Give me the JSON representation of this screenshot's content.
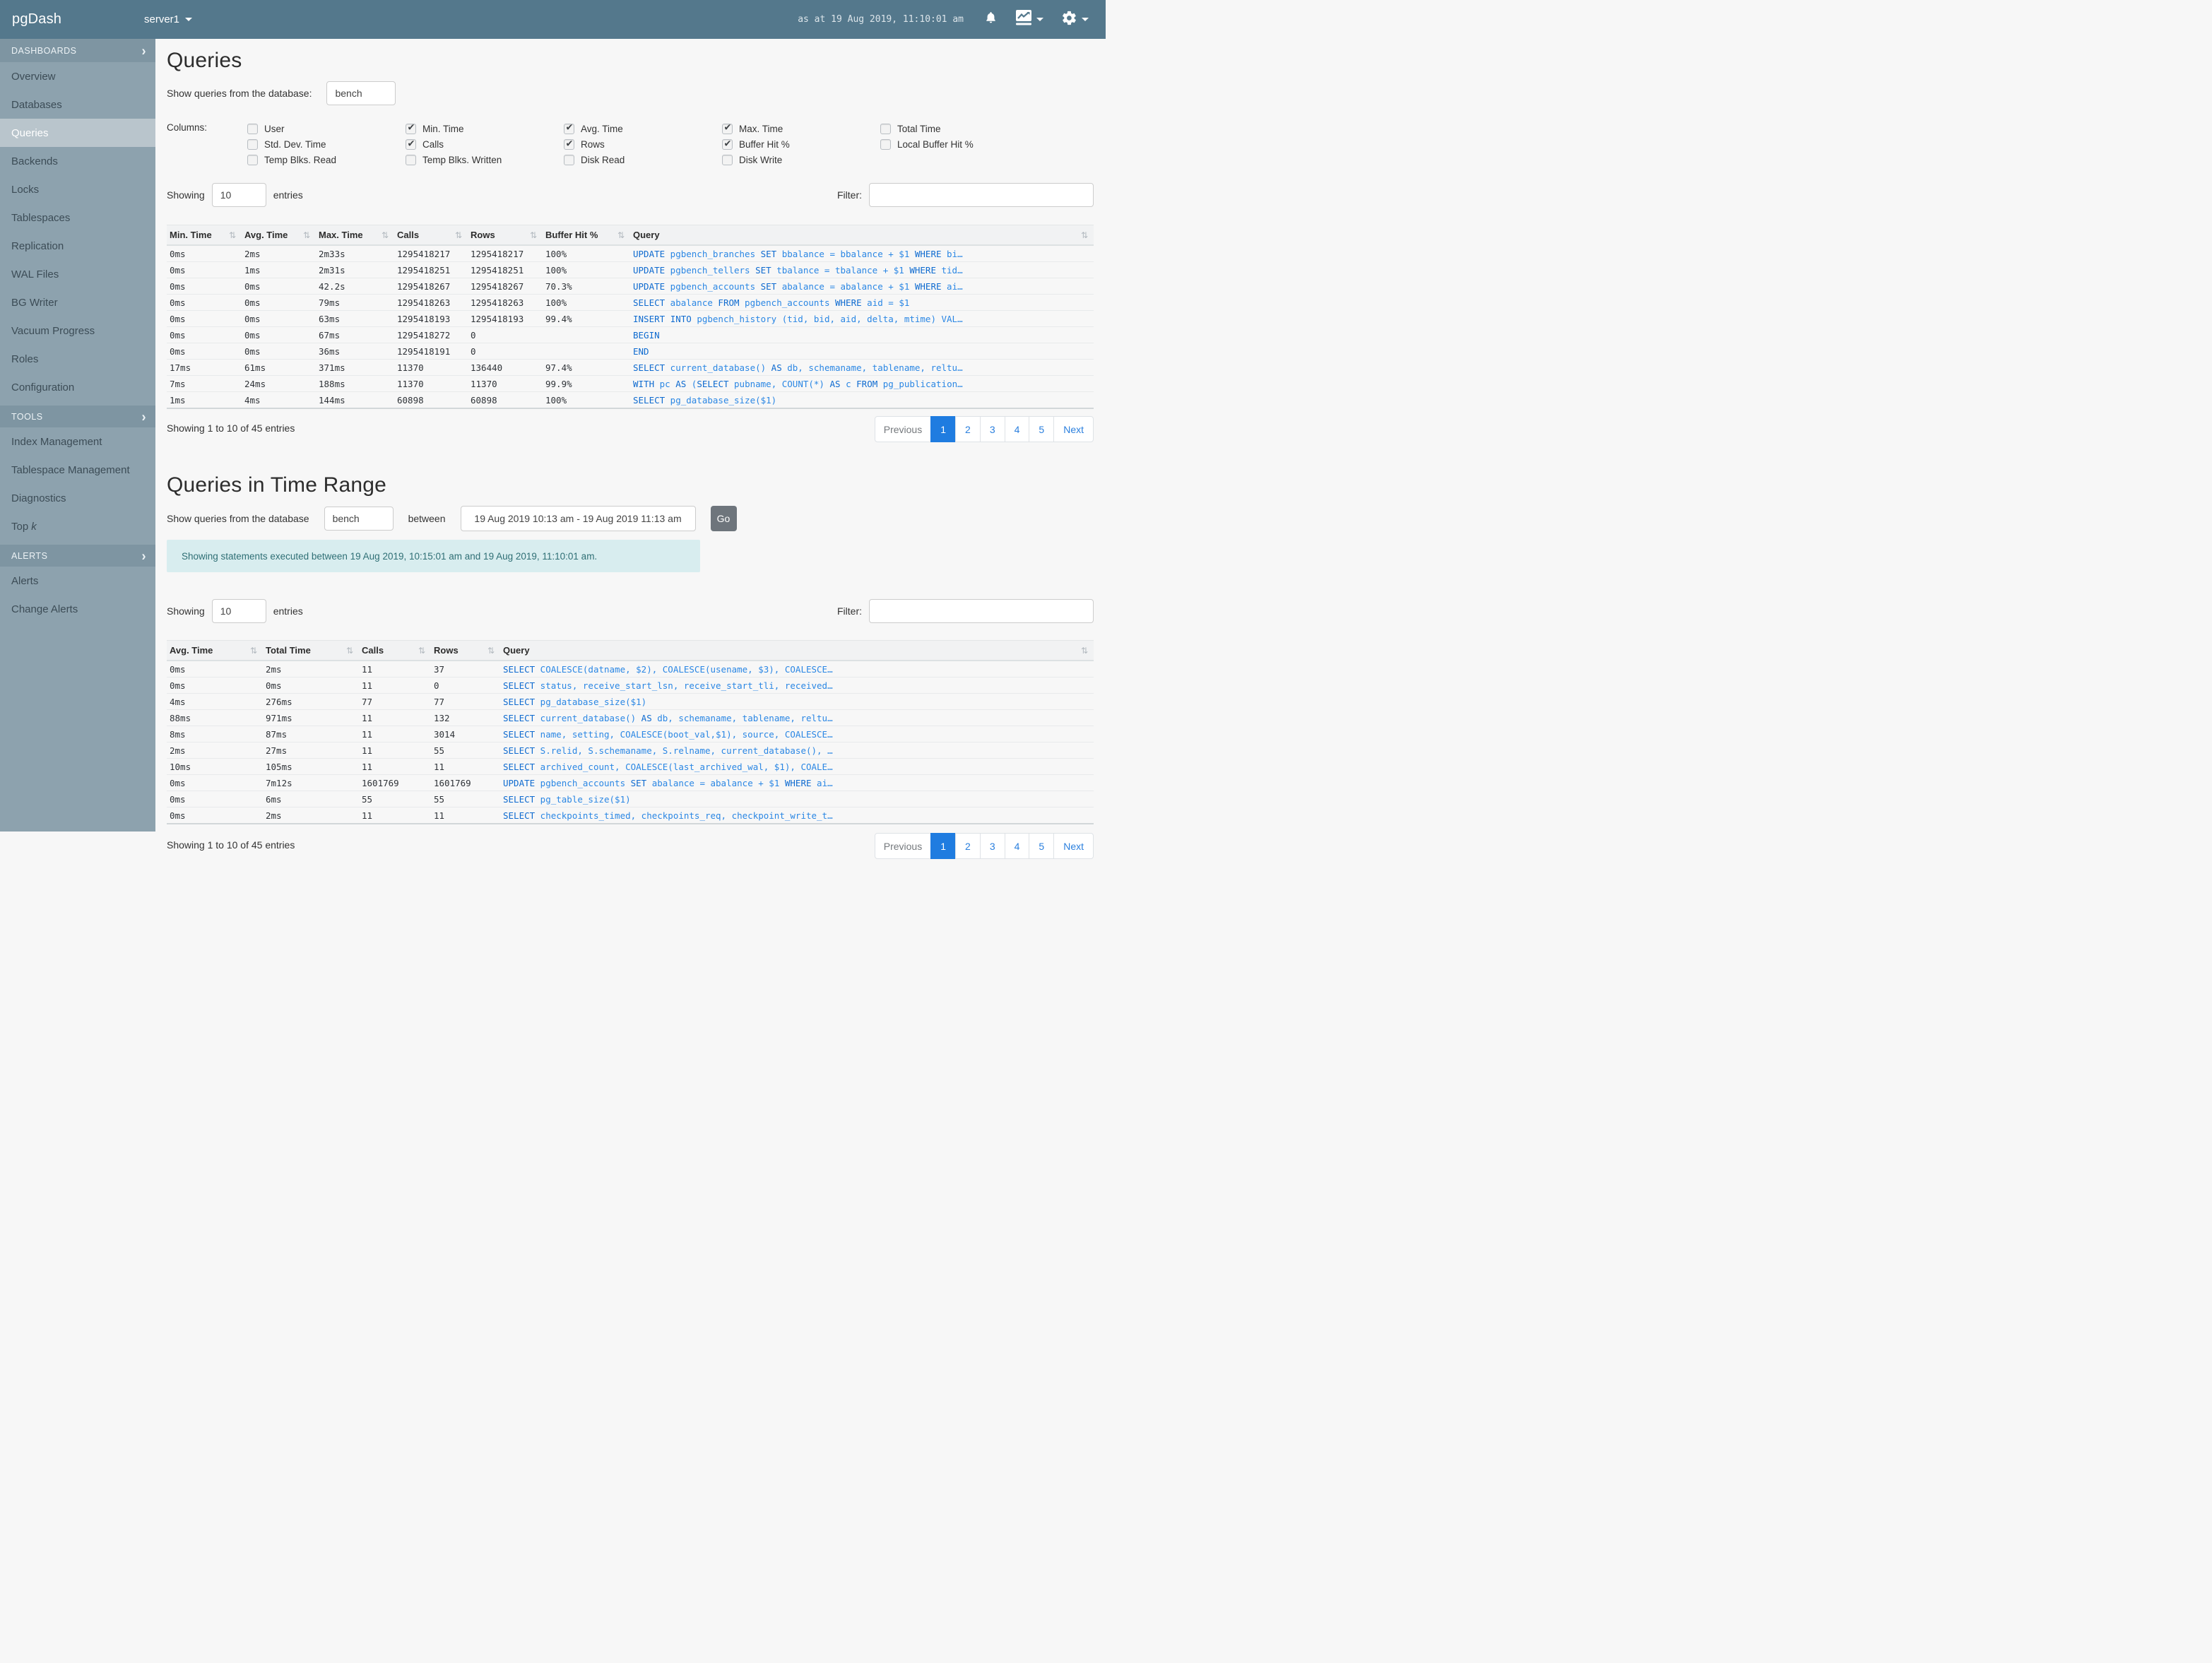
{
  "colors": {
    "navbar_bg": "#54788c",
    "sidebar_bg": "#8da2ae",
    "active_page_bg": "#1f7ce0",
    "query_link": "#2b87e4",
    "banner_bg": "#d8edef",
    "banner_text": "#2f6f75"
  },
  "navbar": {
    "brand": "pgDash",
    "server_selector": "server1",
    "timestamp": "as at 19 Aug 2019, 11:10:01 am",
    "icons": [
      "bell-icon",
      "chart-menu-icon",
      "gear-menu-icon"
    ]
  },
  "sidebar": {
    "sections": [
      {
        "label": "DASHBOARDS",
        "items": [
          {
            "label": "Overview"
          },
          {
            "label": "Databases"
          },
          {
            "label": "Queries",
            "active": true
          },
          {
            "label": "Backends"
          },
          {
            "label": "Locks"
          },
          {
            "label": "Tablespaces"
          },
          {
            "label": "Replication"
          },
          {
            "label": "WAL Files"
          },
          {
            "label": "BG Writer"
          },
          {
            "label": "Vacuum Progress"
          },
          {
            "label": "Roles"
          },
          {
            "label": "Configuration"
          }
        ]
      },
      {
        "label": "TOOLS",
        "items": [
          {
            "label": "Index Management"
          },
          {
            "label": "Tablespace Management"
          },
          {
            "label": "Diagnostics"
          },
          {
            "label": "Top k",
            "italic_last": true
          }
        ]
      },
      {
        "label": "ALERTS",
        "items": [
          {
            "label": "Alerts"
          },
          {
            "label": "Change Alerts"
          }
        ]
      }
    ]
  },
  "queries_section": {
    "title": "Queries",
    "db_label": "Show queries from the database:",
    "db_value": "bench",
    "columns_label": "Columns:",
    "column_groups": [
      [
        {
          "label": "User",
          "checked": false
        },
        {
          "label": "Std. Dev. Time",
          "checked": false
        },
        {
          "label": "Temp Blks. Read",
          "checked": false
        }
      ],
      [
        {
          "label": "Min. Time",
          "checked": true
        },
        {
          "label": "Calls",
          "checked": true
        },
        {
          "label": "Temp Blks. Written",
          "checked": false
        }
      ],
      [
        {
          "label": "Avg. Time",
          "checked": true
        },
        {
          "label": "Rows",
          "checked": true
        },
        {
          "label": "Disk Read",
          "checked": false
        }
      ],
      [
        {
          "label": "Max. Time",
          "checked": true
        },
        {
          "label": "Buffer Hit %",
          "checked": true
        },
        {
          "label": "Disk Write",
          "checked": false
        }
      ],
      [
        {
          "label": "Total Time",
          "checked": false
        },
        {
          "label": "Local Buffer Hit %",
          "checked": false
        }
      ]
    ],
    "showing_label": "Showing",
    "showing_value": "10",
    "entries_label": "entries",
    "filter_label": "Filter:",
    "filter_value": "",
    "table": {
      "columns": [
        "Min. Time",
        "Avg. Time",
        "Max. Time",
        "Calls",
        "Rows",
        "Buffer Hit %",
        "Query"
      ],
      "rows": [
        [
          "0ms",
          "2ms",
          "2m33s",
          "1295418217",
          "1295418217",
          "100%",
          "UPDATE pgbench_branches SET bbalance = bbalance + $1 WHERE bi…"
        ],
        [
          "0ms",
          "1ms",
          "2m31s",
          "1295418251",
          "1295418251",
          "100%",
          "UPDATE pgbench_tellers SET tbalance = tbalance + $1 WHERE tid…"
        ],
        [
          "0ms",
          "0ms",
          "42.2s",
          "1295418267",
          "1295418267",
          "70.3%",
          "UPDATE pgbench_accounts SET abalance = abalance + $1 WHERE ai…"
        ],
        [
          "0ms",
          "0ms",
          "79ms",
          "1295418263",
          "1295418263",
          "100%",
          "SELECT abalance FROM pgbench_accounts WHERE aid = $1"
        ],
        [
          "0ms",
          "0ms",
          "63ms",
          "1295418193",
          "1295418193",
          "99.4%",
          "INSERT INTO pgbench_history (tid, bid, aid, delta, mtime) VAL…"
        ],
        [
          "0ms",
          "0ms",
          "67ms",
          "1295418272",
          "0",
          "",
          "BEGIN"
        ],
        [
          "0ms",
          "0ms",
          "36ms",
          "1295418191",
          "0",
          "",
          "END"
        ],
        [
          "17ms",
          "61ms",
          "371ms",
          "11370",
          "136440",
          "97.4%",
          "SELECT current_database() AS db, schemaname, tablename, reltu…"
        ],
        [
          "7ms",
          "24ms",
          "188ms",
          "11370",
          "11370",
          "99.9%",
          "WITH pc AS (SELECT pubname, COUNT(*) AS c FROM pg_publication…"
        ],
        [
          "1ms",
          "4ms",
          "144ms",
          "60898",
          "60898",
          "100%",
          "SELECT pg_database_size($1)"
        ]
      ]
    },
    "summary": "Showing 1 to 10 of 45 entries",
    "pagination": {
      "previous": "Previous",
      "pages": [
        "1",
        "2",
        "3",
        "4",
        "5"
      ],
      "active": "1",
      "next": "Next"
    }
  },
  "time_range_section": {
    "title": "Queries in Time Range",
    "db_label": "Show queries from the database",
    "db_value": "bench",
    "between_label": "between",
    "range_value": "19 Aug 2019 10:13 am - 19 Aug 2019 11:13 am",
    "go_label": "Go",
    "banner": "Showing statements executed between 19 Aug 2019, 10:15:01 am and 19 Aug 2019, 11:10:01 am.",
    "showing_label": "Showing",
    "showing_value": "10",
    "entries_label": "entries",
    "filter_label": "Filter:",
    "filter_value": "",
    "table": {
      "columns": [
        "Avg. Time",
        "Total Time",
        "Calls",
        "Rows",
        "Query"
      ],
      "rows": [
        [
          "0ms",
          "2ms",
          "11",
          "37",
          "SELECT COALESCE(datname, $2), COALESCE(usename, $3), COALESCE…"
        ],
        [
          "0ms",
          "0ms",
          "11",
          "0",
          "SELECT status, receive_start_lsn, receive_start_tli, received…"
        ],
        [
          "4ms",
          "276ms",
          "77",
          "77",
          "SELECT pg_database_size($1)"
        ],
        [
          "88ms",
          "971ms",
          "11",
          "132",
          "SELECT current_database() AS db, schemaname, tablename, reltu…"
        ],
        [
          "8ms",
          "87ms",
          "11",
          "3014",
          "SELECT name, setting, COALESCE(boot_val,$1), source, COALESCE…"
        ],
        [
          "2ms",
          "27ms",
          "11",
          "55",
          "SELECT S.relid, S.schemaname, S.relname, current_database(), …"
        ],
        [
          "10ms",
          "105ms",
          "11",
          "11",
          "SELECT archived_count, COALESCE(last_archived_wal, $1), COALE…"
        ],
        [
          "0ms",
          "7m12s",
          "1601769",
          "1601769",
          "UPDATE pgbench_accounts SET abalance = abalance + $1 WHERE ai…"
        ],
        [
          "0ms",
          "6ms",
          "55",
          "55",
          "SELECT pg_table_size($1)"
        ],
        [
          "0ms",
          "2ms",
          "11",
          "11",
          "SELECT checkpoints_timed, checkpoints_req, checkpoint_write_t…"
        ]
      ]
    },
    "summary": "Showing 1 to 10 of 45 entries",
    "pagination": {
      "previous": "Previous",
      "pages": [
        "1",
        "2",
        "3",
        "4",
        "5"
      ],
      "active": "1",
      "next": "Next"
    }
  }
}
